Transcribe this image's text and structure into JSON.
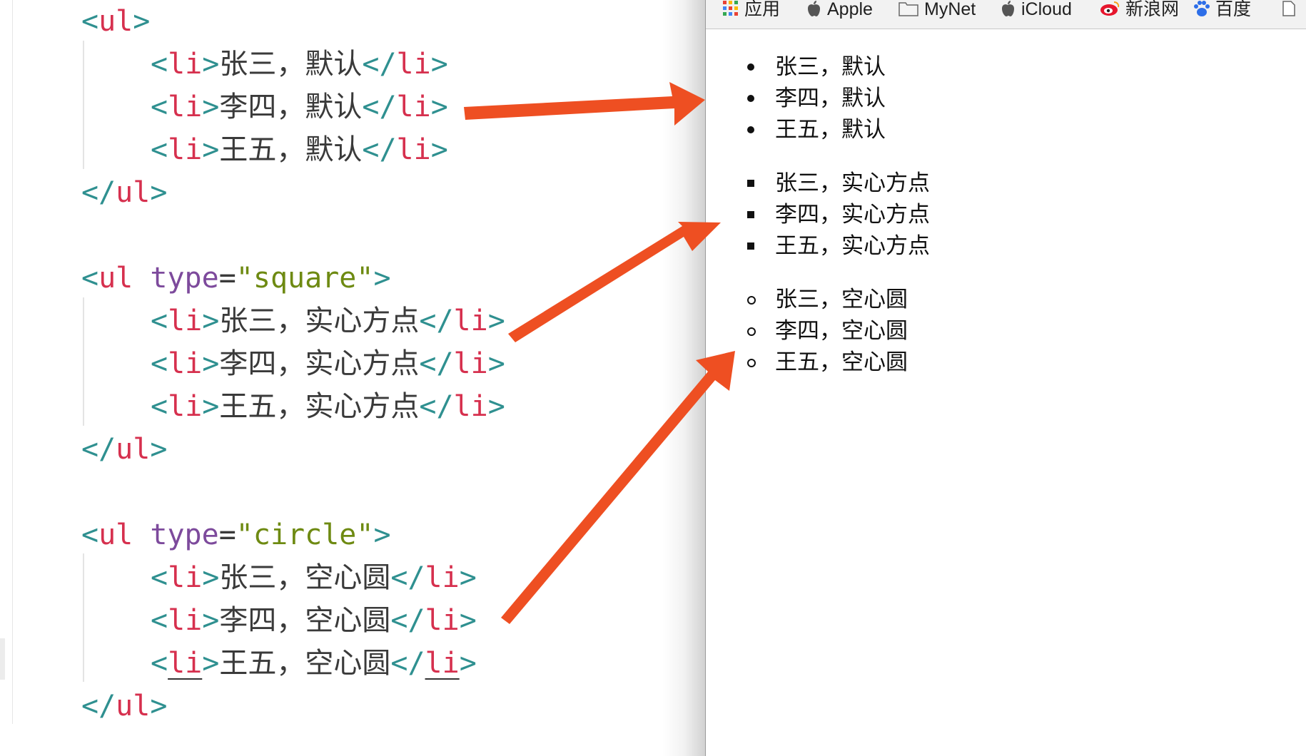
{
  "editor": {
    "blocks": [
      {
        "open": {
          "lt": "<",
          "tag": "ul",
          "gt": ">"
        },
        "items": [
          {
            "open": "<",
            "tag": "li",
            "gt": ">",
            "text": "张三，默认",
            "close_lt": "</",
            "close_tag": "li",
            "close_gt": ">"
          },
          {
            "open": "<",
            "tag": "li",
            "gt": ">",
            "text": "李四，默认",
            "close_lt": "</",
            "close_tag": "li",
            "close_gt": ">"
          },
          {
            "open": "<",
            "tag": "li",
            "gt": ">",
            "text": "王五，默认",
            "close_lt": "</",
            "close_tag": "li",
            "close_gt": ">"
          }
        ],
        "close": {
          "lt": "</",
          "tag": "ul",
          "gt": ">"
        }
      },
      {
        "open": {
          "lt": "<",
          "tag": "ul",
          "attr": "type",
          "eq": "=",
          "value": "\"square\"",
          "gt": ">"
        },
        "items": [
          {
            "open": "<",
            "tag": "li",
            "gt": ">",
            "text": "张三，实心方点",
            "close_lt": "</",
            "close_tag": "li",
            "close_gt": ">"
          },
          {
            "open": "<",
            "tag": "li",
            "gt": ">",
            "text": "李四，实心方点",
            "close_lt": "</",
            "close_tag": "li",
            "close_gt": ">"
          },
          {
            "open": "<",
            "tag": "li",
            "gt": ">",
            "text": "王五，实心方点",
            "close_lt": "</",
            "close_tag": "li",
            "close_gt": ">"
          }
        ],
        "close": {
          "lt": "</",
          "tag": "ul",
          "gt": ">"
        }
      },
      {
        "open": {
          "lt": "<",
          "tag": "ul",
          "attr": "type",
          "eq": "=",
          "value": "\"circle\"",
          "gt": ">"
        },
        "items": [
          {
            "open": "<",
            "tag": "li",
            "gt": ">",
            "text": "张三，空心圆",
            "close_lt": "</",
            "close_tag": "li",
            "close_gt": ">"
          },
          {
            "open": "<",
            "tag": "li",
            "gt": ">",
            "text": "李四，空心圆",
            "close_lt": "</",
            "close_tag": "li",
            "close_gt": ">"
          },
          {
            "open": "<",
            "tag": "li",
            "gt": ">",
            "text": "王五，空心圆",
            "close_lt": "</",
            "close_tag": "li",
            "close_gt": ">"
          }
        ],
        "close": {
          "lt": "</",
          "tag": "ul",
          "gt": ">"
        }
      }
    ]
  },
  "browser": {
    "bookmarks": [
      {
        "label": "应用",
        "icon": "apps-grid-icon"
      },
      {
        "label": "Apple",
        "icon": "apple-icon"
      },
      {
        "label": "MyNet",
        "icon": "folder-icon"
      },
      {
        "label": "iCloud",
        "icon": "apple-icon"
      },
      {
        "label": "新浪网",
        "icon": "weibo-icon"
      },
      {
        "label": "百度",
        "icon": "baidu-paw-icon"
      },
      {
        "label": "",
        "icon": "page-icon"
      }
    ],
    "lists": [
      {
        "type": "disc",
        "items": [
          "张三，默认",
          "李四，默认",
          "王五，默认"
        ]
      },
      {
        "type": "square",
        "items": [
          "张三，实心方点",
          "李四，实心方点",
          "王五，实心方点"
        ]
      },
      {
        "type": "circle",
        "items": [
          "张三，空心圆",
          "李四，空心圆",
          "王五，空心圆"
        ]
      }
    ]
  },
  "annotations": {
    "arrow_color": "#ee4f22"
  },
  "colors": {
    "tag_bracket": "#2f9090",
    "tag_name": "#d6304e",
    "attribute": "#7d4a9c",
    "string": "#6e8a12"
  }
}
